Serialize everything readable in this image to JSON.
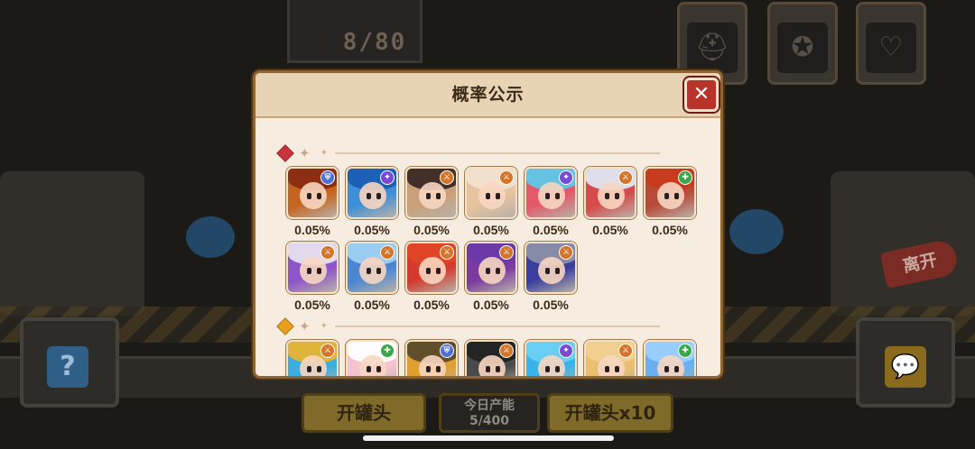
{
  "background": {
    "counter": "8/80",
    "help_glyph": "?",
    "chat_glyph": "💬",
    "leave_label": "离开",
    "open_can_label": "开罐头",
    "open_can_x10_label": "开罐头x10",
    "today_capacity_label": "今日产能",
    "today_capacity_value": "5/400",
    "slot_icons": [
      "helmet-icon",
      "star-badge-icon",
      "heart-icon"
    ]
  },
  "modal": {
    "title": "概率公示",
    "close_glyph": "✕",
    "tiers": [
      {
        "gem_color": "#c8343a",
        "heroes": [
          {
            "probability": "0.05%",
            "class_icon": "shield-icon",
            "class_color": "#4d6fd6",
            "bg": "#c5641f",
            "hair": "#8a2b12"
          },
          {
            "probability": "0.05%",
            "class_icon": "magic-icon",
            "class_color": "#7a4bd1",
            "bg": "#3e8fd8",
            "hair": "#1b5fb5"
          },
          {
            "probability": "0.05%",
            "class_icon": "sword-icon",
            "class_color": "#d4752a",
            "bg": "#c9a07a",
            "hair": "#3b2a24"
          },
          {
            "probability": "0.05%",
            "class_icon": "sword-icon",
            "class_color": "#d4752a",
            "bg": "#e7c39f",
            "hair": "#f0e2cf"
          },
          {
            "probability": "0.05%",
            "class_icon": "magic-icon",
            "class_color": "#7a4bd1",
            "bg": "#e25a6a",
            "hair": "#5fc8e8"
          },
          {
            "probability": "0.05%",
            "class_icon": "sword-icon",
            "class_color": "#d4752a",
            "bg": "#d54a4a",
            "hair": "#dfe6f2"
          },
          {
            "probability": "0.05%",
            "class_icon": "heal-icon",
            "class_color": "#3aa84a",
            "bg": "#b84a3a",
            "hair": "#c93a1e"
          },
          {
            "probability": "0.05%",
            "class_icon": "sword-icon",
            "class_color": "#d4752a",
            "bg": "#8e55c8",
            "hair": "#e8e0f0"
          },
          {
            "probability": "0.05%",
            "class_icon": "sword-icon",
            "class_color": "#d4752a",
            "bg": "#4c86d2",
            "hair": "#9fd0f2"
          },
          {
            "probability": "0.05%",
            "class_icon": "sword-icon",
            "class_color": "#d4752a",
            "bg": "#d63a2e",
            "hair": "#e04628"
          },
          {
            "probability": "0.05%",
            "class_icon": "sword-icon",
            "class_color": "#d4752a",
            "bg": "#7b3aa0",
            "hair": "#6a3aa8"
          },
          {
            "probability": "0.05%",
            "class_icon": "sword-icon",
            "class_color": "#d4752a",
            "bg": "#3a3f9e",
            "hair": "#8c8fa8"
          }
        ]
      },
      {
        "gem_color": "#e8a020",
        "heroes": [
          {
            "probability": "",
            "class_icon": "sword-icon",
            "class_color": "#d4752a",
            "bg": "#3aaee0",
            "hair": "#e8b430"
          },
          {
            "probability": "",
            "class_icon": "heal-icon",
            "class_color": "#3aa84a",
            "bg": "#f4c2d0",
            "hair": "#ffffff"
          },
          {
            "probability": "",
            "class_icon": "shield-icon",
            "class_color": "#4d6fd6",
            "bg": "#e0a030",
            "hair": "#5a4a2a"
          },
          {
            "probability": "",
            "class_icon": "sword-icon",
            "class_color": "#d4752a",
            "bg": "#4a4a4a",
            "hair": "#222222"
          },
          {
            "probability": "",
            "class_icon": "magic-icon",
            "class_color": "#7a4bd1",
            "bg": "#3ab4e8",
            "hair": "#6ad0f4"
          },
          {
            "probability": "",
            "class_icon": "sword-icon",
            "class_color": "#d4752a",
            "bg": "#e8c070",
            "hair": "#f0d090"
          },
          {
            "probability": "",
            "class_icon": "heal-icon",
            "class_color": "#3aa84a",
            "bg": "#6ab0f0",
            "hair": "#9ad0ff"
          }
        ]
      }
    ]
  }
}
